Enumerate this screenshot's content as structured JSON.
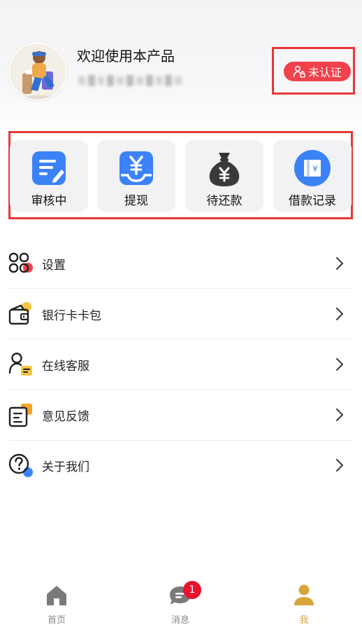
{
  "header": {
    "welcome_text": "欢迎使用本产品",
    "verify_badge_label": "未认证"
  },
  "quick_actions": [
    {
      "label": "审核中",
      "icon": "edit-document-icon"
    },
    {
      "label": "提现",
      "icon": "yen-tray-icon"
    },
    {
      "label": "待还款",
      "icon": "money-bag-icon"
    },
    {
      "label": "借款记录",
      "icon": "yen-book-icon"
    }
  ],
  "menu": [
    {
      "label": "设置",
      "icon": "settings-grid-icon"
    },
    {
      "label": "银行卡卡包",
      "icon": "wallet-icon"
    },
    {
      "label": "在线客服",
      "icon": "customer-service-icon"
    },
    {
      "label": "意见反馈",
      "icon": "feedback-icon"
    },
    {
      "label": "关于我们",
      "icon": "help-icon"
    }
  ],
  "tabbar": {
    "home": "首页",
    "messages": "消息",
    "messages_badge": "1",
    "me": "我"
  },
  "colors": {
    "accent_red": "#f0414c",
    "highlight_frame": "#e53935",
    "action_blue": "#3b82f6",
    "active_tab": "#d9a43b",
    "badge_red": "#e8132c"
  }
}
